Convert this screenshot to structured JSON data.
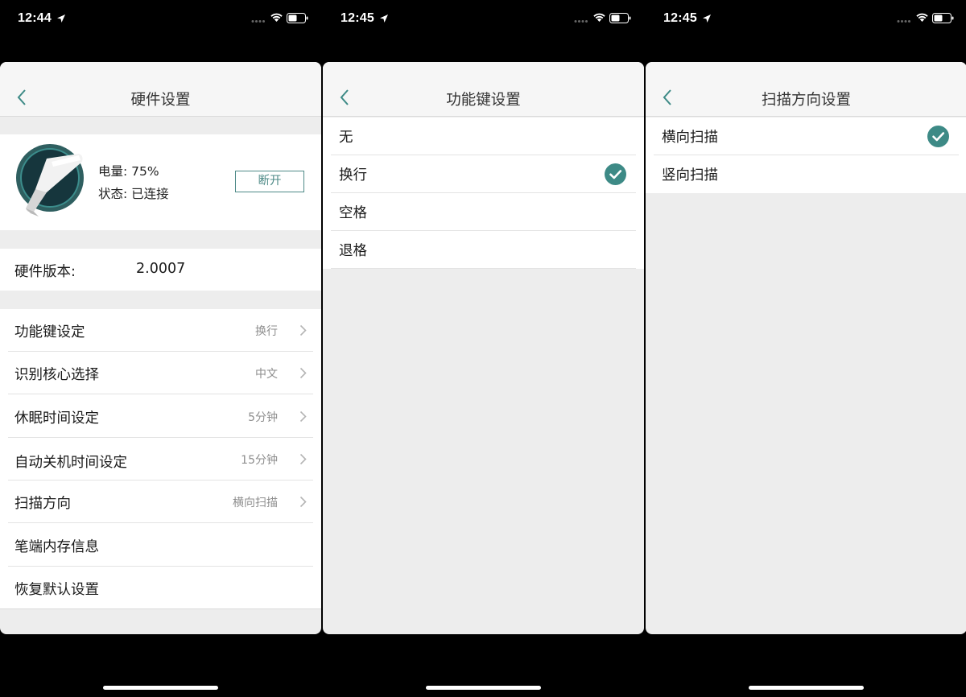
{
  "accent_color": "#3d8a86",
  "screens": [
    {
      "status": {
        "time": "12:44"
      },
      "nav": {
        "title": "硬件设置"
      },
      "device": {
        "battery_label": "电量: ",
        "battery_value": "75%",
        "status_label": "状态: ",
        "status_value": "已连接",
        "disconnect_label": "断开"
      },
      "version": {
        "label": "硬件版本:",
        "value": "2.0007"
      },
      "settings": [
        {
          "label": "功能键设定",
          "value": "换行"
        },
        {
          "label": "识别核心选择",
          "value": "中文"
        },
        {
          "label": "休眠时间设定",
          "value": "5分钟"
        },
        {
          "label": "自动关机时间设定",
          "value": "15分钟"
        },
        {
          "label": "扫描方向",
          "value": "横向扫描"
        },
        {
          "label": "笔端内存信息",
          "value": ""
        },
        {
          "label": "恢复默认设置",
          "value": ""
        }
      ]
    },
    {
      "status": {
        "time": "12:45"
      },
      "nav": {
        "title": "功能键设置"
      },
      "options": [
        {
          "label": "无",
          "selected": false
        },
        {
          "label": "换行",
          "selected": true
        },
        {
          "label": "空格",
          "selected": false
        },
        {
          "label": "退格",
          "selected": false
        }
      ]
    },
    {
      "status": {
        "time": "12:45"
      },
      "nav": {
        "title": "扫描方向设置"
      },
      "options": [
        {
          "label": "横向扫描",
          "selected": true
        },
        {
          "label": "竖向扫描",
          "selected": false
        }
      ]
    }
  ]
}
